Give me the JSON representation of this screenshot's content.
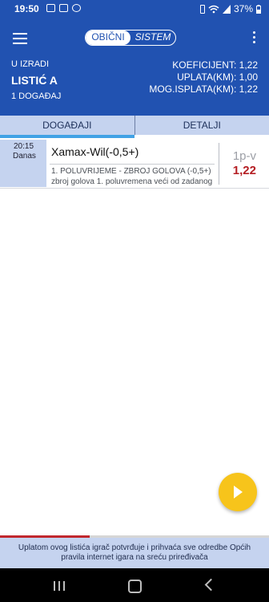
{
  "status_bar": {
    "time": "19:50",
    "battery": "37%"
  },
  "header": {
    "toggle": {
      "active": "OBIČNI",
      "inactive": "SISTEM"
    },
    "state_label": "U IZRADI",
    "ticket_title": "LISTIĆ A",
    "events_count": "1 DOGAĐAJ",
    "stats": [
      "KOEFICIJENT: 1,22",
      "UPLATA(KM): 1,00",
      "MOG.ISPLATA(KM): 1,22"
    ]
  },
  "tabs": [
    {
      "label": "DOGAĐAJI",
      "active": true
    },
    {
      "label": "DETALJI",
      "active": false
    }
  ],
  "event": {
    "time": "20:15",
    "day": "Danas",
    "match": "Xamax-Wil(-0,5+)",
    "market": "1. POLUVRIJEME - ZBROJ GOLOVA (-0,5+)",
    "description": "zbroj golova 1. poluvremena veći od zadanog",
    "pick": "1p-v",
    "odds": "1,22"
  },
  "footer": {
    "text": "Uplatom ovog listića igrač potvrđuje i prihvaća sve odredbe Općih pravila internet igara na sreću priređivača"
  },
  "colors": {
    "primary": "#2152b1",
    "accent": "#f7c41b",
    "odds": "#b51f24",
    "tab_bg": "#c5d3ef"
  }
}
